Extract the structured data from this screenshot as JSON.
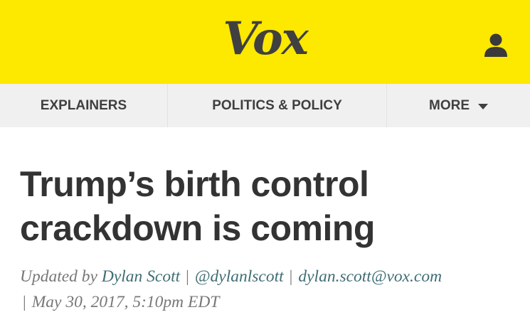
{
  "header": {
    "logo_text": "Vox",
    "user_icon": "user-icon",
    "background_color": "#fde800"
  },
  "nav": {
    "items": [
      {
        "label": "EXPLAINERS"
      },
      {
        "label": "POLITICS & POLICY"
      },
      {
        "label": "MORE",
        "icon": "caret-down-icon"
      }
    ]
  },
  "article": {
    "headline_line1": "Trump’s birth control",
    "headline_line2": "crackdown is coming",
    "byline": {
      "prefix": "Updated by",
      "author": "Dylan Scott",
      "separator": "|",
      "twitter": "@dylanlscott",
      "email": "dylan.scott@vox.com",
      "date": "May 30, 2017, 5:10pm EDT",
      "link_color": "#3f6d74"
    }
  }
}
